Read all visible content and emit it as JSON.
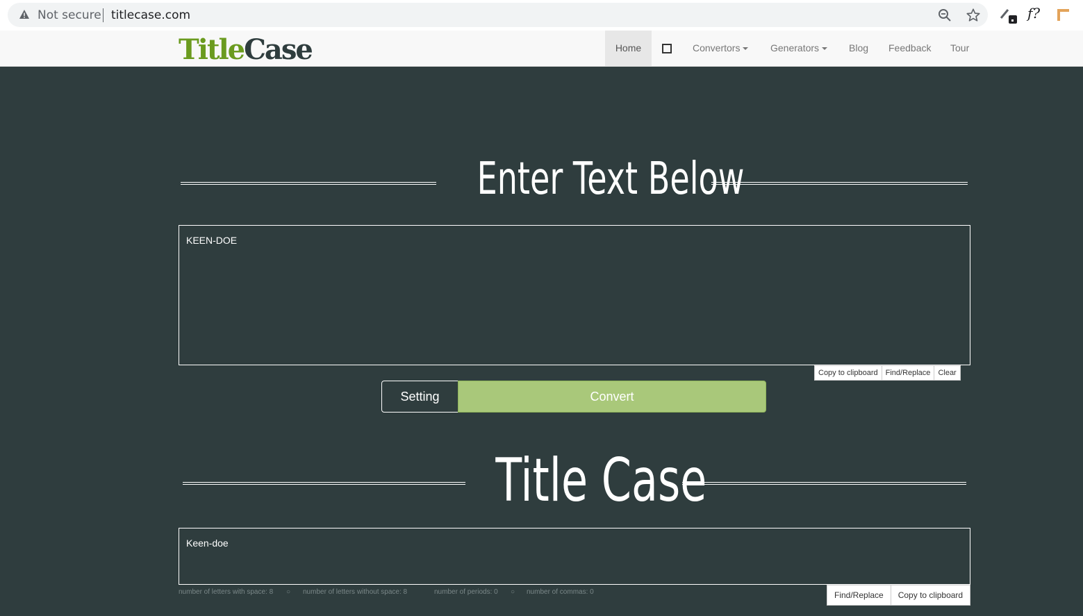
{
  "browser": {
    "security_label": "Not secure",
    "url": "titlecase.com",
    "ext_label": "f?"
  },
  "nav": {
    "logo_part1": "Title",
    "logo_part2": "Case",
    "home": "Home",
    "convertors": "Convertors",
    "generators": "Generators",
    "blog": "Blog",
    "feedback": "Feedback",
    "tour": "Tour"
  },
  "input_section": {
    "heading": "Enter Text Below",
    "text": "KEEN-DOE",
    "copy_label": "Copy to clipboard",
    "find_replace_label": "Find/Replace",
    "clear_label": "Clear"
  },
  "actions": {
    "setting_label": "Setting",
    "convert_label": "Convert"
  },
  "output_section": {
    "heading": "Title Case",
    "text": "Keen-doe",
    "find_replace_label": "Find/Replace",
    "copy_label": "Copy to clipboard"
  },
  "stats": {
    "letters_with_space": "number of letters with space: 8",
    "letters_without_space": "number of letters without space: 8",
    "periods": "number of periods: 0",
    "commas": "number of commas: 0",
    "separator": "○"
  },
  "colors": {
    "page_bg": "#2f3d3e",
    "convert_green": "#a9c87a",
    "logo_green": "#6b9b1f"
  }
}
